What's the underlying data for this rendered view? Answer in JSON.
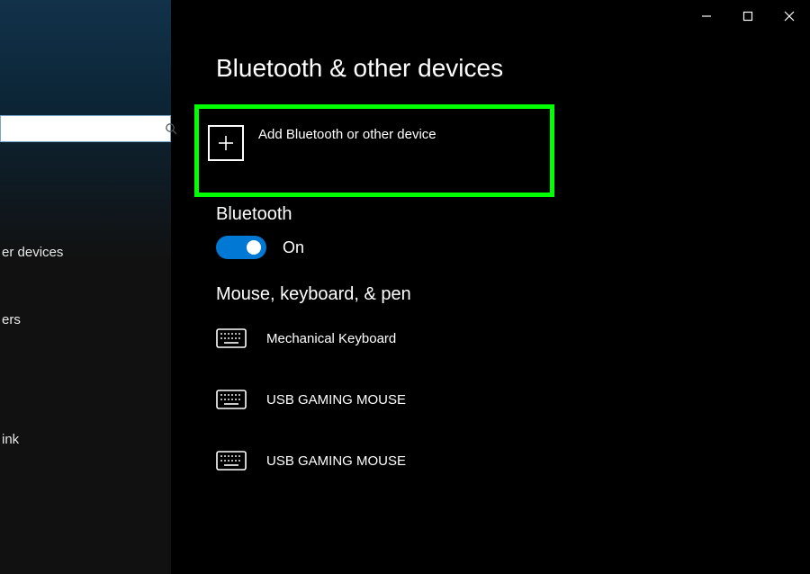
{
  "titlebar": {
    "minimize": "minimize",
    "maximize": "maximize",
    "close": "close"
  },
  "sidebar": {
    "search_placeholder": "",
    "items": [
      {
        "label": "er devices"
      },
      {
        "label": "ers"
      },
      {
        "label": ""
      },
      {
        "label": "ink"
      }
    ]
  },
  "page": {
    "title": "Bluetooth & other devices"
  },
  "add": {
    "label": "Add Bluetooth or other device"
  },
  "bluetooth": {
    "heading": "Bluetooth",
    "state": "On"
  },
  "devices": {
    "heading": "Mouse, keyboard, & pen",
    "list": [
      {
        "name": "Mechanical Keyboard"
      },
      {
        "name": "USB GAMING MOUSE"
      },
      {
        "name": "USB GAMING MOUSE"
      }
    ]
  }
}
